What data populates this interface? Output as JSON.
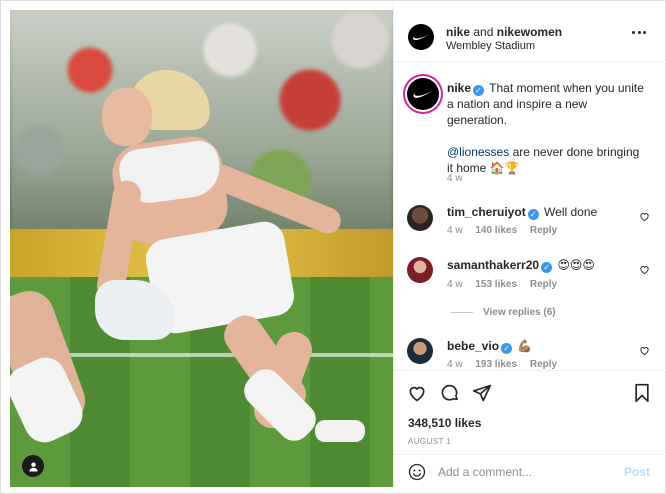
{
  "header": {
    "account": "nike",
    "connector": "and",
    "collaborator": "nikewomen",
    "location": "Wembley Stadium"
  },
  "caption": {
    "username": "nike",
    "line1": "That moment when you unite a nation and inspire a new generation.",
    "mention": "@lionesses",
    "line2": "are never done bringing it home 🏠🏆",
    "age": "4 w"
  },
  "comments": [
    {
      "username": "tim_cheruiyot",
      "verified": true,
      "text": "Well done",
      "age": "4 w",
      "likes": "140 likes",
      "reply": "Reply"
    },
    {
      "username": "samanthakerr20",
      "verified": true,
      "text": "😍😍😍",
      "age": "4 w",
      "likes": "153 likes",
      "reply": "Reply"
    },
    {
      "username": "bebe_vio",
      "verified": true,
      "text": "💪🏽",
      "age": "4 w",
      "likes": "193 likes",
      "reply": "Reply"
    }
  ],
  "view_replies": "View replies (6)",
  "likes_count": "348,510 likes",
  "post_date": "AUGUST 1",
  "add_comment": {
    "placeholder": "Add a comment...",
    "post_label": "Post"
  },
  "icons": [
    "nike-logo-icon",
    "more-options-icon",
    "verified-icon",
    "heart-icon",
    "comment-icon",
    "share-icon",
    "bookmark-icon",
    "emoji-icon",
    "tag-user-icon"
  ],
  "colors": {
    "verified": "#3897f0",
    "post_disabled": "#b2dffc",
    "story_ring": "#d6249f"
  }
}
